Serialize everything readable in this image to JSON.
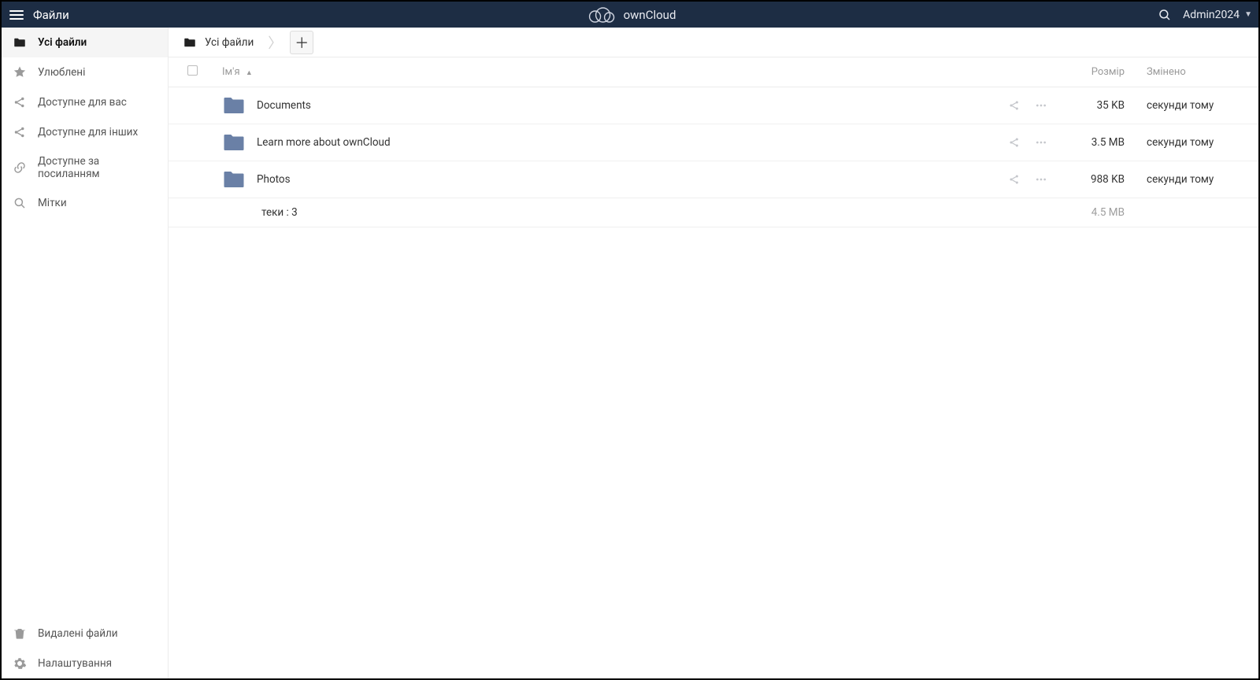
{
  "header": {
    "app_title": "Файли",
    "brand": "ownCloud",
    "user": "Admin2024"
  },
  "sidebar": {
    "items": [
      {
        "label": "Усі файли",
        "icon": "folder-icon",
        "active": true
      },
      {
        "label": "Улюблені",
        "icon": "star-icon",
        "active": false
      },
      {
        "label": "Доступне для вас",
        "icon": "share-icon",
        "active": false
      },
      {
        "label": "Доступне для інших",
        "icon": "share-icon",
        "active": false
      },
      {
        "label": "Доступне за посиланням",
        "icon": "link-icon",
        "active": false
      },
      {
        "label": "Мітки",
        "icon": "search-icon",
        "active": false
      }
    ],
    "bottom": [
      {
        "label": "Видалені файли",
        "icon": "trash-icon"
      },
      {
        "label": "Налаштування",
        "icon": "gear-icon"
      }
    ]
  },
  "breadcrumb": {
    "root_label": "Усі файли"
  },
  "table": {
    "columns": {
      "name": "Ім'я",
      "size": "Розмір",
      "modified": "Змінено"
    },
    "sort_indicator": "▲",
    "rows": [
      {
        "name": "Documents",
        "size": "35 KB",
        "modified": "секунди тому"
      },
      {
        "name": "Learn more about ownCloud",
        "size": "3.5 MB",
        "modified": "секунди тому"
      },
      {
        "name": "Photos",
        "size": "988 KB",
        "modified": "секунди тому"
      }
    ],
    "summary": {
      "label": "теки : 3",
      "total_size": "4.5 MB"
    }
  }
}
